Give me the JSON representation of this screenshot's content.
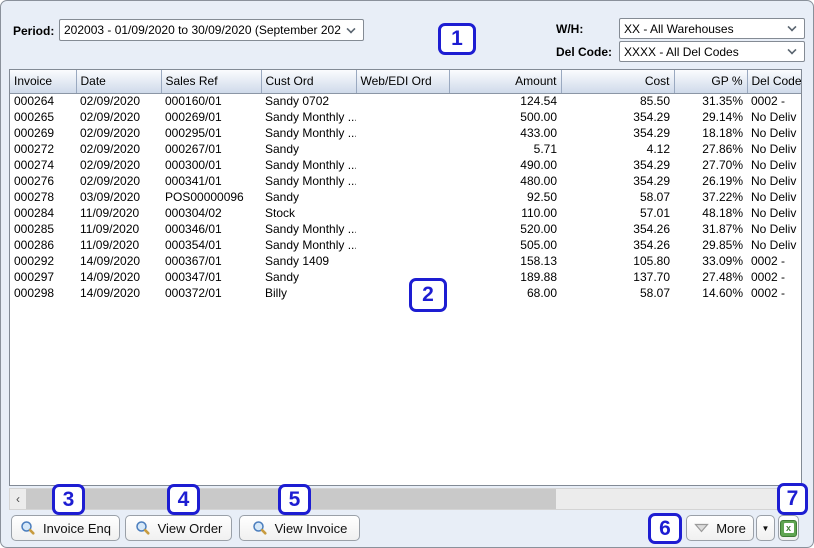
{
  "filters": {
    "period": {
      "label": "Period:",
      "value": "202003 - 01/09/2020 to 30/09/2020 (September 202"
    },
    "warehouse": {
      "label": "W/H:",
      "value": "XX - All Warehouses"
    },
    "del_code": {
      "label": "Del Code:",
      "value": "XXXX - All Del Codes"
    }
  },
  "table": {
    "columns": [
      "Invoice",
      "Date",
      "Sales Ref",
      "Cust Ord",
      "Web/EDI Ord",
      "Amount",
      "Cost",
      "GP %",
      "Del Code"
    ],
    "rows": [
      [
        "000264",
        "02/09/2020",
        "000160/01",
        "Sandy 0702",
        "",
        "124.54",
        "85.50",
        "31.35%",
        "0002 -"
      ],
      [
        "000265",
        "02/09/2020",
        "000269/01",
        "Sandy Monthly ...",
        "",
        "500.00",
        "354.29",
        "29.14%",
        "No Deliv"
      ],
      [
        "000269",
        "02/09/2020",
        "000295/01",
        "Sandy Monthly ...",
        "",
        "433.00",
        "354.29",
        "18.18%",
        "No Deliv"
      ],
      [
        "000272",
        "02/09/2020",
        "000267/01",
        "Sandy",
        "",
        "5.71",
        "4.12",
        "27.86%",
        "No Deliv"
      ],
      [
        "000274",
        "02/09/2020",
        "000300/01",
        "Sandy Monthly ...",
        "",
        "490.00",
        "354.29",
        "27.70%",
        "No Deliv"
      ],
      [
        "000276",
        "02/09/2020",
        "000341/01",
        "Sandy Monthly ...",
        "",
        "480.00",
        "354.29",
        "26.19%",
        "No Deliv"
      ],
      [
        "000278",
        "03/09/2020",
        "POS00000096",
        "Sandy",
        "",
        "92.50",
        "58.07",
        "37.22%",
        "No Deliv"
      ],
      [
        "000284",
        "11/09/2020",
        "000304/02",
        "Stock",
        "",
        "110.00",
        "57.01",
        "48.18%",
        "No Deliv"
      ],
      [
        "000285",
        "11/09/2020",
        "000346/01",
        "Sandy Monthly ...",
        "",
        "520.00",
        "354.26",
        "31.87%",
        "No Deliv"
      ],
      [
        "000286",
        "11/09/2020",
        "000354/01",
        "Sandy Monthly ...",
        "",
        "505.00",
        "354.26",
        "29.85%",
        "No Deliv"
      ],
      [
        "000292",
        "14/09/2020",
        "000367/01",
        "Sandy 1409",
        "",
        "158.13",
        "105.80",
        "33.09%",
        "0002 -"
      ],
      [
        "000297",
        "14/09/2020",
        "000347/01",
        "Sandy",
        "",
        "189.88",
        "137.70",
        "27.48%",
        "0002 -"
      ],
      [
        "000298",
        "14/09/2020",
        "000372/01",
        "Billy",
        "",
        "68.00",
        "58.07",
        "14.60%",
        "0002 -"
      ]
    ]
  },
  "buttons": {
    "invoice_enq": "Invoice Enq",
    "view_order": "View Order",
    "view_invoice": "View Invoice",
    "more": "More",
    "more_arrow": "▼"
  },
  "scrollbar": {
    "left_arrow": "‹"
  },
  "icons": {
    "magnifier": "search-icon",
    "excel_glyph": "x"
  },
  "badges": [
    "1",
    "2",
    "3",
    "4",
    "5",
    "6",
    "7"
  ],
  "colors": {
    "badge_accent": "#1d1dd2",
    "panel_bg": "#e8eef7",
    "header_gradient_bottom": "#cfdaea",
    "excel_green": "#5fa551"
  }
}
